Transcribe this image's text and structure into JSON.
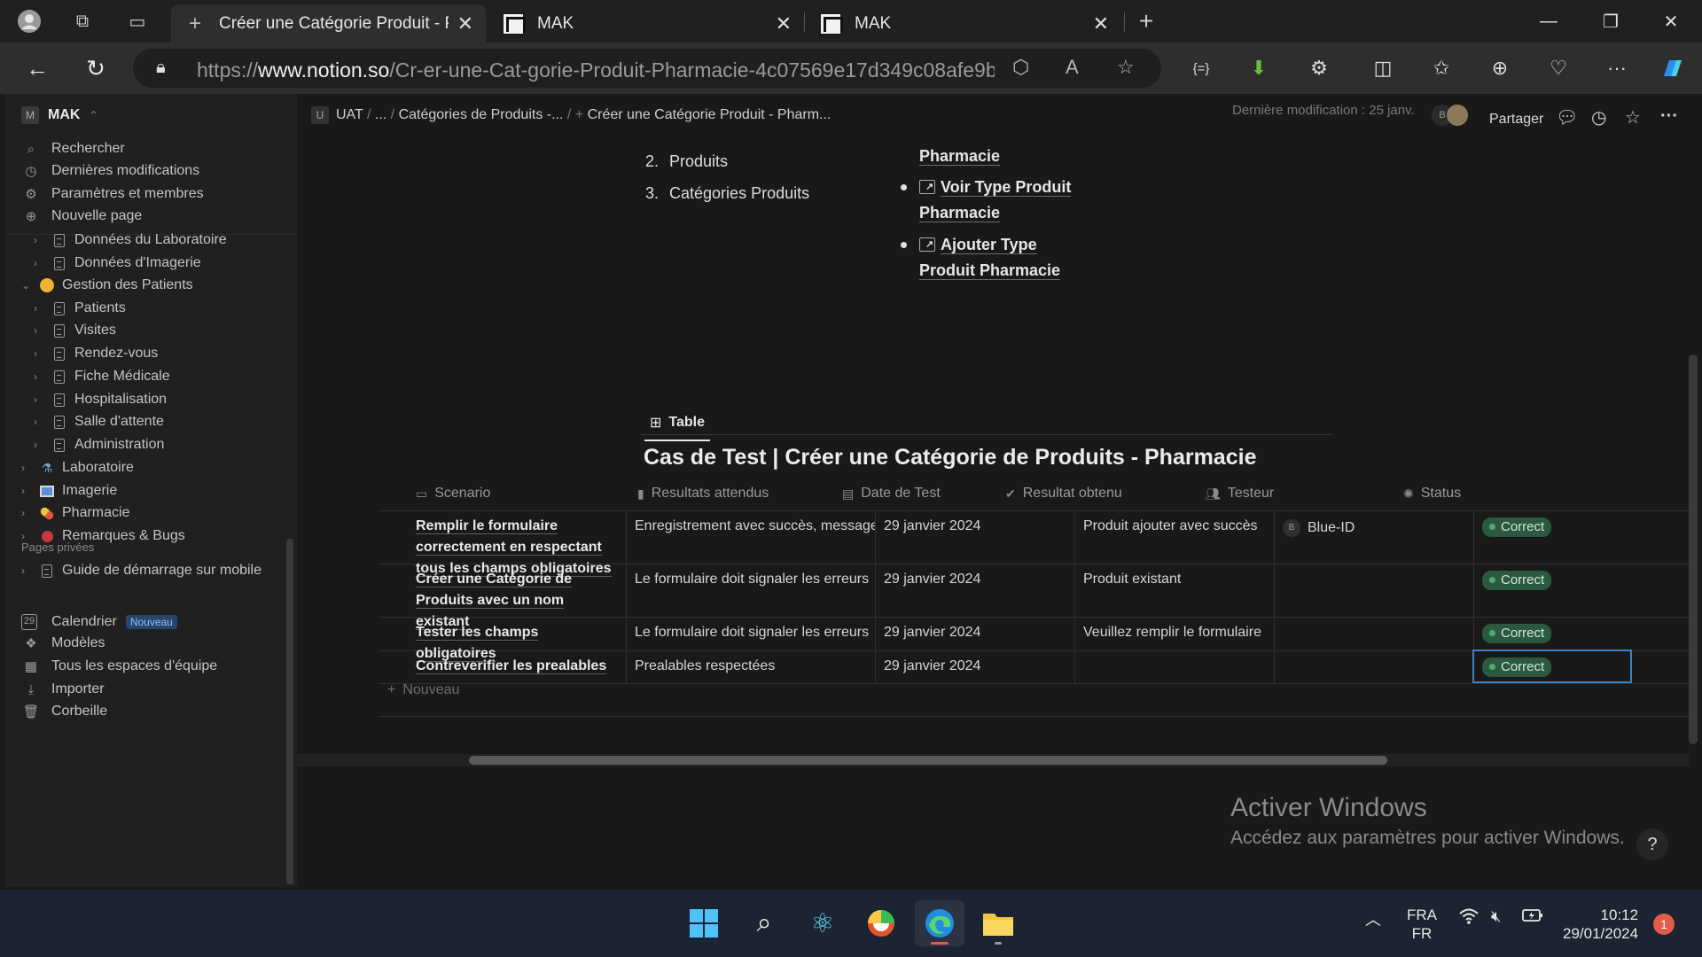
{
  "browser": {
    "tabs": [
      {
        "title": "Créer une Catégorie Produit - Ph",
        "active": true
      },
      {
        "title": "MAK",
        "active": false
      },
      {
        "title": "MAK",
        "active": false
      }
    ],
    "address": {
      "prefix": "https://",
      "domain": "www.notion.so",
      "path": "/Cr-er-une-Cat-gorie-Produit-Pharmacie-4c07569e17d349c08afe9bb6b9..."
    }
  },
  "sidebar": {
    "workspace": "MAK",
    "workspace_initial": "M",
    "top_items": [
      {
        "label": "Rechercher",
        "icon": "search-icon"
      },
      {
        "label": "Dernières modifications",
        "icon": "clock-icon"
      },
      {
        "label": "Paramètres et membres",
        "icon": "gear-icon"
      },
      {
        "label": "Nouvelle page",
        "icon": "plus-circle-icon"
      }
    ],
    "tree": [
      {
        "label": "Données du Laboratoire"
      },
      {
        "label": "Données d'Imagerie"
      },
      {
        "label": "Gestion des Patients"
      },
      {
        "label": "Patients"
      },
      {
        "label": "Visites"
      },
      {
        "label": "Rendez-vous"
      },
      {
        "label": "Fiche Médicale"
      },
      {
        "label": "Hospitalisation"
      },
      {
        "label": "Salle d'attente"
      },
      {
        "label": "Administration"
      },
      {
        "label": "Laboratoire"
      },
      {
        "label": "Imagerie"
      },
      {
        "label": "Pharmacie"
      },
      {
        "label": "Remarques & Bugs"
      }
    ],
    "private_section": "Pages privées",
    "private_items": [
      {
        "label": "Guide de démarrage sur mobile"
      }
    ],
    "bottom_items": [
      {
        "label": "Calendrier",
        "badge": "Nouveau",
        "icon": "calendar-icon"
      },
      {
        "label": "Modèles",
        "icon": "templates-icon"
      },
      {
        "label": "Tous les espaces d'équipe",
        "icon": "teamspaces-icon"
      },
      {
        "label": "Importer",
        "icon": "import-icon"
      },
      {
        "label": "Corbeille",
        "icon": "trash-icon"
      }
    ]
  },
  "pagebar": {
    "crumb_initial": "U",
    "breadcrumbs": [
      "UAT",
      "...",
      "Catégories de Produits -...",
      "Créer une Catégorie Produit - Pharm..."
    ],
    "last_modified": "Dernière modification : 25 janv.",
    "avatar_initial": "B",
    "share_label": "Partager"
  },
  "content": {
    "ordered_list": [
      {
        "num": "2.",
        "text": "Produits"
      },
      {
        "num": "3.",
        "text": "Catégories Produits"
      }
    ],
    "bullets": {
      "partial": "Pharmacie",
      "items": [
        {
          "line1": "Voir Type Produit",
          "line2": "Pharmacie"
        },
        {
          "line1": "Ajouter Type",
          "line2": "Produit Pharmacie"
        }
      ]
    },
    "view_tab": "Table",
    "db_title": "Cas de Test | Créer une Catégorie de Produits - Pharmacie",
    "columns": [
      "Scenario",
      "Resultats attendus",
      "Date de Test",
      "Resultat obtenu",
      "Testeur",
      "Status"
    ],
    "rows": [
      {
        "scenario": "Remplir le formulaire correctement en respectant tous les champs obligatoires",
        "attendu": "Enregistrement avec succès, message d",
        "date": "29 janvier 2024",
        "obtenu": "Produit ajouter avec succès",
        "testeur": "Blue-ID",
        "testeur_initial": "B",
        "status": "Correct"
      },
      {
        "scenario": "Créer une Catégorie de Produits avec un nom existant",
        "attendu": "Le formulaire doit signaler les erreurs",
        "date": "29 janvier 2024",
        "obtenu": "Produit existant",
        "testeur": "",
        "testeur_initial": "",
        "status": "Correct"
      },
      {
        "scenario": "Tester les champs obligatoires",
        "attendu": "Le formulaire doit signaler les erreurs",
        "date": "29 janvier 2024",
        "obtenu": "Veuillez remplir le formulaire",
        "testeur": "",
        "testeur_initial": "",
        "status": "Correct"
      },
      {
        "scenario": "Contreverifier les prealables",
        "attendu": "Prealables respectées",
        "date": "29 janvier 2024",
        "obtenu": "",
        "testeur": "",
        "testeur_initial": "",
        "status": "Correct"
      }
    ],
    "new_row": "Nouveau"
  },
  "watermark": {
    "title": "Activer Windows",
    "subtitle": "Accédez aux paramètres pour activer Windows."
  },
  "taskbar": {
    "lang1": "FRA",
    "lang2": "FR",
    "time": "10:12",
    "date": "29/01/2024",
    "notifications": "1"
  },
  "colors": {
    "status_green": "#2b593f",
    "selection_blue": "#3b82c4",
    "background": "#191919"
  }
}
